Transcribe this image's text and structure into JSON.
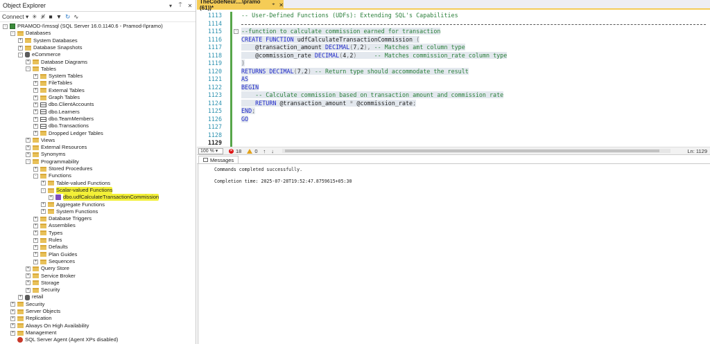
{
  "object_explorer": {
    "title": "Object Explorer",
    "pin_icon": "▾",
    "pin2_icon": "⍑",
    "close_icon": "✕",
    "toolbar": {
      "connect_label": "Connect ▾",
      "icons": [
        "✳",
        "✳̸",
        "■",
        "▼",
        "↻",
        "∿"
      ]
    },
    "tree": [
      {
        "level": 0,
        "exp": "-",
        "icon": "server",
        "label": "PRAMOD-I\\mssql (SQL Server 16.0.1140.6 - Pramod-I\\pramo)"
      },
      {
        "level": 1,
        "exp": "-",
        "icon": "folder",
        "label": "Databases"
      },
      {
        "level": 2,
        "exp": "+",
        "icon": "folder",
        "label": "System Databases"
      },
      {
        "level": 2,
        "exp": "+",
        "icon": "folder",
        "label": "Database Snapshots"
      },
      {
        "level": 2,
        "exp": "-",
        "icon": "db",
        "label": "eCommerce"
      },
      {
        "level": 3,
        "exp": "+",
        "icon": "folder",
        "label": "Database Diagrams"
      },
      {
        "level": 3,
        "exp": "-",
        "icon": "folder",
        "label": "Tables"
      },
      {
        "level": 4,
        "exp": "+",
        "icon": "folder",
        "label": "System Tables"
      },
      {
        "level": 4,
        "exp": "+",
        "icon": "folder",
        "label": "FileTables"
      },
      {
        "level": 4,
        "exp": "+",
        "icon": "folder",
        "label": "External Tables"
      },
      {
        "level": 4,
        "exp": "+",
        "icon": "folder",
        "label": "Graph Tables"
      },
      {
        "level": 4,
        "exp": "+",
        "icon": "table",
        "label": "dbo.ClientAccounts"
      },
      {
        "level": 4,
        "exp": "+",
        "icon": "table",
        "label": "dbo.Learners"
      },
      {
        "level": 4,
        "exp": "+",
        "icon": "table",
        "label": "dbo.TeamMembers"
      },
      {
        "level": 4,
        "exp": "+",
        "icon": "table",
        "label": "dbo.Transactions"
      },
      {
        "level": 4,
        "exp": "+",
        "icon": "folder",
        "label": "Dropped Ledger Tables"
      },
      {
        "level": 3,
        "exp": "+",
        "icon": "folder",
        "label": "Views"
      },
      {
        "level": 3,
        "exp": "+",
        "icon": "folder",
        "label": "External Resources"
      },
      {
        "level": 3,
        "exp": "+",
        "icon": "folder",
        "label": "Synonyms"
      },
      {
        "level": 3,
        "exp": "-",
        "icon": "folder",
        "label": "Programmability"
      },
      {
        "level": 4,
        "exp": "+",
        "icon": "folder",
        "label": "Stored Procedures"
      },
      {
        "level": 4,
        "exp": "-",
        "icon": "folder",
        "label": "Functions"
      },
      {
        "level": 5,
        "exp": "+",
        "icon": "folder",
        "label": "Table-valued Functions"
      },
      {
        "level": 5,
        "exp": "-",
        "icon": "folder",
        "label": "Scalar-valued Functions",
        "highlight": true
      },
      {
        "level": 6,
        "exp": "+",
        "icon": "func",
        "label": "dbo.udfCalculateTransactionCommission",
        "highlight": true
      },
      {
        "level": 5,
        "exp": "+",
        "icon": "folder",
        "label": "Aggregate Functions"
      },
      {
        "level": 5,
        "exp": "+",
        "icon": "folder",
        "label": "System Functions"
      },
      {
        "level": 4,
        "exp": "+",
        "icon": "folder",
        "label": "Database Triggers"
      },
      {
        "level": 4,
        "exp": "+",
        "icon": "folder",
        "label": "Assemblies"
      },
      {
        "level": 4,
        "exp": "+",
        "icon": "folder",
        "label": "Types"
      },
      {
        "level": 4,
        "exp": "+",
        "icon": "folder",
        "label": "Rules"
      },
      {
        "level": 4,
        "exp": "+",
        "icon": "folder",
        "label": "Defaults"
      },
      {
        "level": 4,
        "exp": "+",
        "icon": "folder",
        "label": "Plan Guides"
      },
      {
        "level": 4,
        "exp": "+",
        "icon": "folder",
        "label": "Sequences"
      },
      {
        "level": 3,
        "exp": "+",
        "icon": "folder",
        "label": "Query Store"
      },
      {
        "level": 3,
        "exp": "+",
        "icon": "folder",
        "label": "Service Broker"
      },
      {
        "level": 3,
        "exp": "+",
        "icon": "folder",
        "label": "Storage"
      },
      {
        "level": 3,
        "exp": "+",
        "icon": "folder",
        "label": "Security"
      },
      {
        "level": 2,
        "exp": "+",
        "icon": "db",
        "label": "retail"
      },
      {
        "level": 1,
        "exp": "+",
        "icon": "folder",
        "label": "Security"
      },
      {
        "level": 1,
        "exp": "+",
        "icon": "folder",
        "label": "Server Objects"
      },
      {
        "level": 1,
        "exp": "+",
        "icon": "folder",
        "label": "Replication"
      },
      {
        "level": 1,
        "exp": "+",
        "icon": "folder",
        "label": "Always On High Availability"
      },
      {
        "level": 1,
        "exp": "+",
        "icon": "folder",
        "label": "Management"
      },
      {
        "level": 1,
        "exp": "none",
        "icon": "agent",
        "label": "SQL Server Agent (Agent XPs disabled)"
      }
    ]
  },
  "editor": {
    "tab_label": "TheCodeNeur....\\pramo (61))*",
    "tab_pin": "⌖",
    "tab_close": "✕",
    "lines": [
      {
        "n": "1113",
        "parts": [
          [
            "cm",
            "-- User-Defined Functions (UDFs): Extending SQL's Capabilities"
          ]
        ]
      },
      {
        "n": "1114",
        "dash": true,
        "parts": []
      },
      {
        "n": "1115",
        "sel": true,
        "collapse": "-",
        "parts": [
          [
            "cm",
            "--function to calculate commission earned for transaction"
          ]
        ]
      },
      {
        "n": "1116",
        "sel": true,
        "parts": [
          [
            "kw",
            "CREATE FUNCTION "
          ],
          [
            "nm",
            "udfCalculateTransactionCommission "
          ],
          [
            "gy",
            "("
          ]
        ]
      },
      {
        "n": "1117",
        "sel": true,
        "parts": [
          [
            "nm",
            "    @transaction_amount "
          ],
          [
            "kw",
            "DECIMAL"
          ],
          [
            "gy",
            "("
          ],
          [
            "nm",
            "7"
          ],
          [
            "gy",
            ","
          ],
          [
            "nm",
            "2"
          ],
          [
            "gy",
            "), "
          ],
          [
            "cm",
            "-- Matches amt column type"
          ]
        ]
      },
      {
        "n": "1118",
        "sel": true,
        "parts": [
          [
            "nm",
            "    @commission_rate "
          ],
          [
            "kw",
            "DECIMAL"
          ],
          [
            "gy",
            "("
          ],
          [
            "nm",
            "4"
          ],
          [
            "gy",
            ","
          ],
          [
            "nm",
            "2"
          ],
          [
            "gy",
            ")     "
          ],
          [
            "cm",
            "-- Matches commission_rate column type"
          ]
        ]
      },
      {
        "n": "1119",
        "sel": true,
        "parts": [
          [
            "gy",
            ")"
          ]
        ]
      },
      {
        "n": "1120",
        "sel": true,
        "parts": [
          [
            "kw",
            "RETURNS DECIMAL"
          ],
          [
            "gy",
            "("
          ],
          [
            "nm",
            "7"
          ],
          [
            "gy",
            ","
          ],
          [
            "nm",
            "2"
          ],
          [
            "gy",
            ") "
          ],
          [
            "cm",
            "-- Return type should accommodate the result"
          ]
        ]
      },
      {
        "n": "1121",
        "sel": true,
        "parts": [
          [
            "kw",
            "AS"
          ]
        ]
      },
      {
        "n": "1122",
        "sel": true,
        "parts": [
          [
            "kw",
            "BEGIN"
          ]
        ]
      },
      {
        "n": "1123",
        "sel": true,
        "parts": [
          [
            "cm",
            "    -- Calculate commission based on transaction amount and commission rate"
          ]
        ]
      },
      {
        "n": "1124",
        "sel": true,
        "parts": [
          [
            "kw",
            "    RETURN "
          ],
          [
            "nm",
            "@transaction_amount "
          ],
          [
            "gy",
            "* "
          ],
          [
            "nm",
            "@commission_rate"
          ],
          [
            "gy",
            ";"
          ]
        ]
      },
      {
        "n": "1125",
        "sel": true,
        "parts": [
          [
            "kw",
            "END"
          ],
          [
            "gy",
            ";"
          ]
        ]
      },
      {
        "n": "1126",
        "sel": true,
        "parts": [
          [
            "kw",
            "GO"
          ]
        ]
      },
      {
        "n": "1127",
        "parts": []
      },
      {
        "n": "1128",
        "parts": []
      },
      {
        "n": "1129",
        "cur": true,
        "parts": []
      }
    ],
    "status": {
      "zoom": "100 % ▾",
      "errors": "18",
      "warnings": "0",
      "up": "↑",
      "down": "↓",
      "ln": "Ln: 1129"
    }
  },
  "messages": {
    "tab_label": "Messages",
    "lines": [
      "Commands completed successfully.",
      "",
      "Completion time: 2025-07-28T19:52:47.8759615+05:30"
    ]
  }
}
